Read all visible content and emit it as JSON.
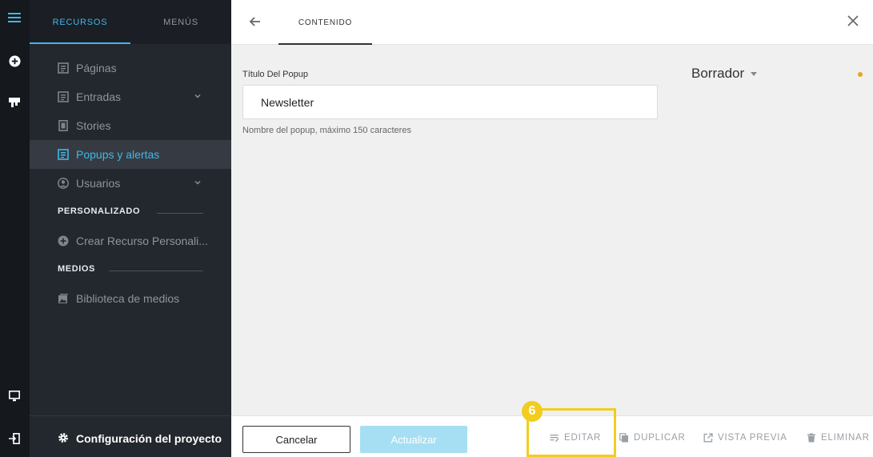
{
  "rail": {
    "icons": [
      "menu-icon",
      "add-circle-icon",
      "tools-icon",
      "monitor-icon",
      "logout-icon"
    ]
  },
  "sidebar": {
    "tabs": [
      {
        "label": "RECURSOS",
        "active": true
      },
      {
        "label": "MENÚS",
        "active": false
      }
    ],
    "items": [
      {
        "label": "Páginas",
        "icon": "page-icon"
      },
      {
        "label": "Entradas",
        "icon": "entries-icon",
        "expandable": true
      },
      {
        "label": "Stories",
        "icon": "stories-icon"
      },
      {
        "label": "Popups y alertas",
        "icon": "popup-icon",
        "active": true
      },
      {
        "label": "Usuarios",
        "icon": "user-icon",
        "expandable": true
      }
    ],
    "sections": {
      "custom": {
        "title": "PERSONALIZADO",
        "items": [
          {
            "label": "Crear Recurso Personali...",
            "icon": "add-circle-icon"
          }
        ]
      },
      "media": {
        "title": "MEDIOS",
        "items": [
          {
            "label": "Biblioteca de medios",
            "icon": "image-icon"
          }
        ]
      }
    },
    "footer": {
      "label": "Configuración del proyecto",
      "icon": "gear-icon"
    }
  },
  "main": {
    "tab": "CONTENIDO",
    "field": {
      "label": "Título Del Popup",
      "value": "Newsletter",
      "help": "Nombre del popup, máximo 150 caracteres"
    },
    "status": {
      "label": "Borrador",
      "dot_color": "#e8a524"
    },
    "footer": {
      "cancel": "Cancelar",
      "update": "Actualizar",
      "actions": {
        "edit": "EDITAR",
        "duplicate": "DUPLICAR",
        "preview": "VISTA PREVIA",
        "delete": "ELIMINAR"
      }
    }
  },
  "annotation": {
    "step": "6",
    "color": "#f2cd1f"
  },
  "colors": {
    "accent": "#3fb8e8",
    "sidebar": "#23272e",
    "rail": "#15181d"
  }
}
